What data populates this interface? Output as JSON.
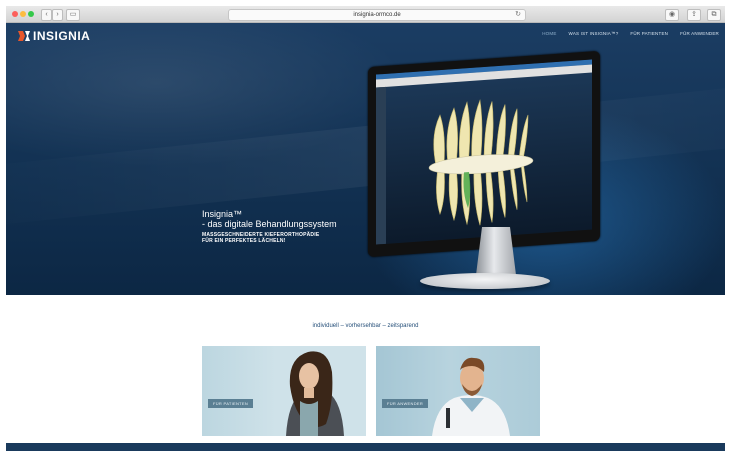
{
  "browser": {
    "url": "insignia-ormco.de"
  },
  "header": {
    "logo_text": "INSIGNIA",
    "nav": [
      {
        "label": "HOME",
        "active": true
      },
      {
        "label": "WAS IST INSIGNIA™?",
        "active": false
      },
      {
        "label": "FÜR PATIENTEN",
        "active": false
      },
      {
        "label": "FÜR ANWENDER",
        "active": false
      }
    ]
  },
  "hero": {
    "title": "Insignia™",
    "subtitle": "- das digitale Behandlungssystem",
    "tagline_line1": "MASSGESCHNEIDERTE KIEFERORTHOPÄDIE",
    "tagline_line2": "FÜR EIN PERFEKTES LÄCHELN!"
  },
  "main": {
    "tagline": "individuell – vorhersehbar – zeitsparend",
    "cards": [
      {
        "button_label": "FÜR PATIENTEN"
      },
      {
        "button_label": "FÜR ANWENDER"
      }
    ]
  },
  "colors": {
    "hero_bg": "#123152",
    "accent": "#27507a",
    "card_button": "#5a7f93"
  }
}
